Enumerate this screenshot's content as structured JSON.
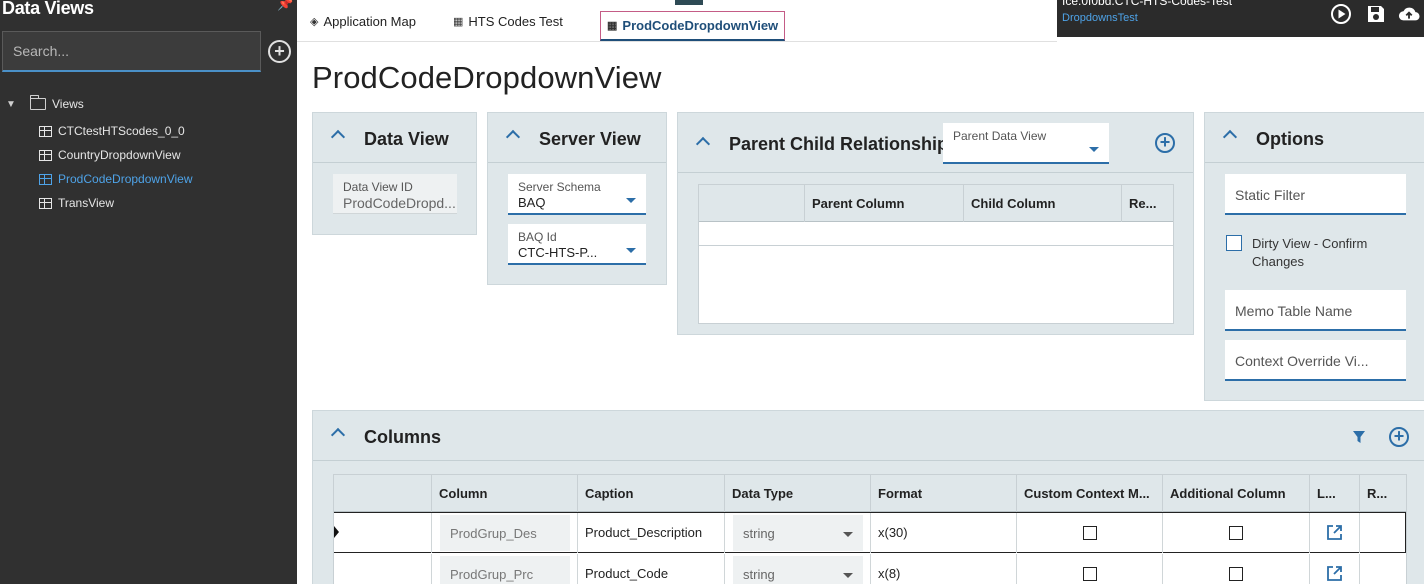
{
  "sidebar": {
    "title": "Data Views",
    "search_placeholder": "Search...",
    "root_label": "Views",
    "items": [
      {
        "label": "CTCtestHTScodes_0_0"
      },
      {
        "label": "CountryDropdownView"
      },
      {
        "label": "ProdCodeDropdownView",
        "selected": true
      },
      {
        "label": "TransView"
      }
    ]
  },
  "tabs": [
    {
      "label": "Application Map",
      "icon": "layers-icon"
    },
    {
      "label": "HTS Codes Test",
      "icon": "table-icon"
    },
    {
      "label": "ProdCodeDropdownView",
      "icon": "grid-view-icon",
      "active": true
    }
  ],
  "topright": {
    "line1": "Ice.0f0bd.CTC-HTS-Codes-Test",
    "line2": "DropdownsTest"
  },
  "page_title": "ProdCodeDropdownView",
  "data_view": {
    "title": "Data View",
    "id_label": "Data View ID",
    "id_value": "ProdCodeDropd..."
  },
  "server_view": {
    "title": "Server View",
    "schema_label": "Server Schema",
    "schema_value": "BAQ",
    "baq_label": "BAQ Id",
    "baq_value": "CTC-HTS-P..."
  },
  "parent_child": {
    "title": "Parent Child Relationships",
    "parent_dv_label": "Parent Data View",
    "columns": [
      "",
      "Parent Column",
      "Child Column",
      "Re..."
    ]
  },
  "options": {
    "title": "Options",
    "static_filter": "Static Filter",
    "dirty_view_label": "Dirty View - Confirm Changes",
    "memo_table": "Memo Table Name",
    "context_override": "Context Override Vi..."
  },
  "columns_panel": {
    "title": "Columns",
    "headers": [
      "",
      "Column",
      "Caption",
      "Data Type",
      "Format",
      "Custom Context M...",
      "Additional Column",
      "L...",
      "R..."
    ],
    "rows": [
      {
        "column": "ProdGrup_Des",
        "caption": "Product_Description",
        "data_type": "string",
        "format": "x(30)"
      },
      {
        "column": "ProdGrup_Prc",
        "caption": "Product_Code",
        "data_type": "string",
        "format": "x(8)"
      }
    ]
  },
  "colors": {
    "accent": "#2c6ea8",
    "sidebar_bg": "#303030",
    "panel_bg": "#dfe7ea",
    "selected": "#4ea3e8"
  }
}
